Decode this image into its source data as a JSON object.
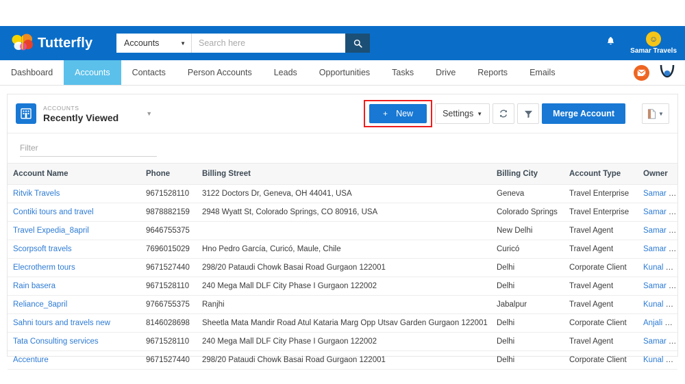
{
  "header": {
    "brand_name": "Tutterfly",
    "search_scope": "Accounts",
    "search_placeholder": "Search here",
    "search_value": "",
    "bell_icon": "bell-icon",
    "user_name": "Samar Travels"
  },
  "nav": {
    "items": [
      {
        "label": "Dashboard",
        "active": false
      },
      {
        "label": "Accounts",
        "active": true
      },
      {
        "label": "Contacts",
        "active": false
      },
      {
        "label": "Person Accounts",
        "active": false
      },
      {
        "label": "Leads",
        "active": false
      },
      {
        "label": "Opportunities",
        "active": false
      },
      {
        "label": "Tasks",
        "active": false
      },
      {
        "label": "Drive",
        "active": false
      },
      {
        "label": "Reports",
        "active": false
      },
      {
        "label": "Emails",
        "active": false
      }
    ],
    "mail_icon": "mail-compose-icon",
    "chat_icon": "chat-icon"
  },
  "list_view": {
    "kicker": "ACCOUNTS",
    "title": "Recently Viewed",
    "object_icon": "building-icon",
    "dropdown_caret": "chevron-down-icon"
  },
  "toolbar": {
    "new_label": "New",
    "new_plus": "+",
    "settings_label": "Settings",
    "refresh_icon": "refresh-icon",
    "filter_icon": "funnel-icon",
    "merge_label": "Merge Account",
    "export_icon": "document-icon",
    "highlight_color": "#ee1d1d",
    "primary_color": "#1878d4"
  },
  "filter": {
    "placeholder": "Filter",
    "value": ""
  },
  "table": {
    "columns": [
      "Account Name",
      "Phone",
      "Billing Street",
      "Billing City",
      "Account Type",
      "Owner"
    ],
    "rows": [
      {
        "account_name": "Ritvik Travels",
        "phone": "9671528110",
        "billing_street": "3122 Doctors Dr, Geneva, OH 44041, USA",
        "billing_city": "Geneva",
        "account_type": "Travel Enterprise",
        "owner": "Samar Travels"
      },
      {
        "account_name": "Contiki tours and travel",
        "phone": "9878882159",
        "billing_street": "2948 Wyatt St, Colorado Springs, CO 80916, USA",
        "billing_city": "Colorado Springs",
        "account_type": "Travel Enterprise",
        "owner": "Samar Travels"
      },
      {
        "account_name": "Travel Expedia_8april",
        "phone": "9646755375",
        "billing_street": "",
        "billing_city": "New Delhi",
        "account_type": "Travel Agent",
        "owner": "Samar Travels"
      },
      {
        "account_name": "Scorpsoft travels",
        "phone": "7696015029",
        "billing_street": "Hno Pedro García, Curicó, Maule, Chile",
        "billing_city": "Curicó",
        "account_type": "Travel Agent",
        "owner": "Samar Travels"
      },
      {
        "account_name": "Elecrotherm tours",
        "phone": "9671527440",
        "billing_street": "298/20 Pataudi Chowk Basai Road Gurgaon 122001",
        "billing_city": "Delhi",
        "account_type": "Corporate Client",
        "owner": "Kunal Kapoor"
      },
      {
        "account_name": "Rain basera",
        "phone": "9671528110",
        "billing_street": "240 Mega Mall DLF City Phase I Gurgaon 122002",
        "billing_city": "Delhi",
        "account_type": "Travel Agent",
        "owner": "Samar Travels"
      },
      {
        "account_name": "Reliance_8april",
        "phone": "9766755375",
        "billing_street": "Ranjhi",
        "billing_city": "Jabalpur",
        "account_type": "Travel Agent",
        "owner": "Kunal Kapoor"
      },
      {
        "account_name": "Sahni tours and travels new",
        "phone": "8146028698",
        "billing_street": "Sheetla Mata Mandir Road Atul Kataria Marg Opp Utsav Garden Gurgaon 122001",
        "billing_city": "Delhi",
        "account_type": "Corporate Client",
        "owner": "Anjali Gupta"
      },
      {
        "account_name": "Tata Consulting services",
        "phone": "9671528110",
        "billing_street": "240 Mega Mall DLF City Phase I Gurgaon 122002",
        "billing_city": "Delhi",
        "account_type": "Travel Agent",
        "owner": "Samar Travels"
      },
      {
        "account_name": "Accenture",
        "phone": "9671527440",
        "billing_street": "298/20 Pataudi Chowk Basai Road Gurgaon 122001",
        "billing_city": "Delhi",
        "account_type": "Corporate Client",
        "owner": "Kunal Kapoor"
      }
    ]
  }
}
